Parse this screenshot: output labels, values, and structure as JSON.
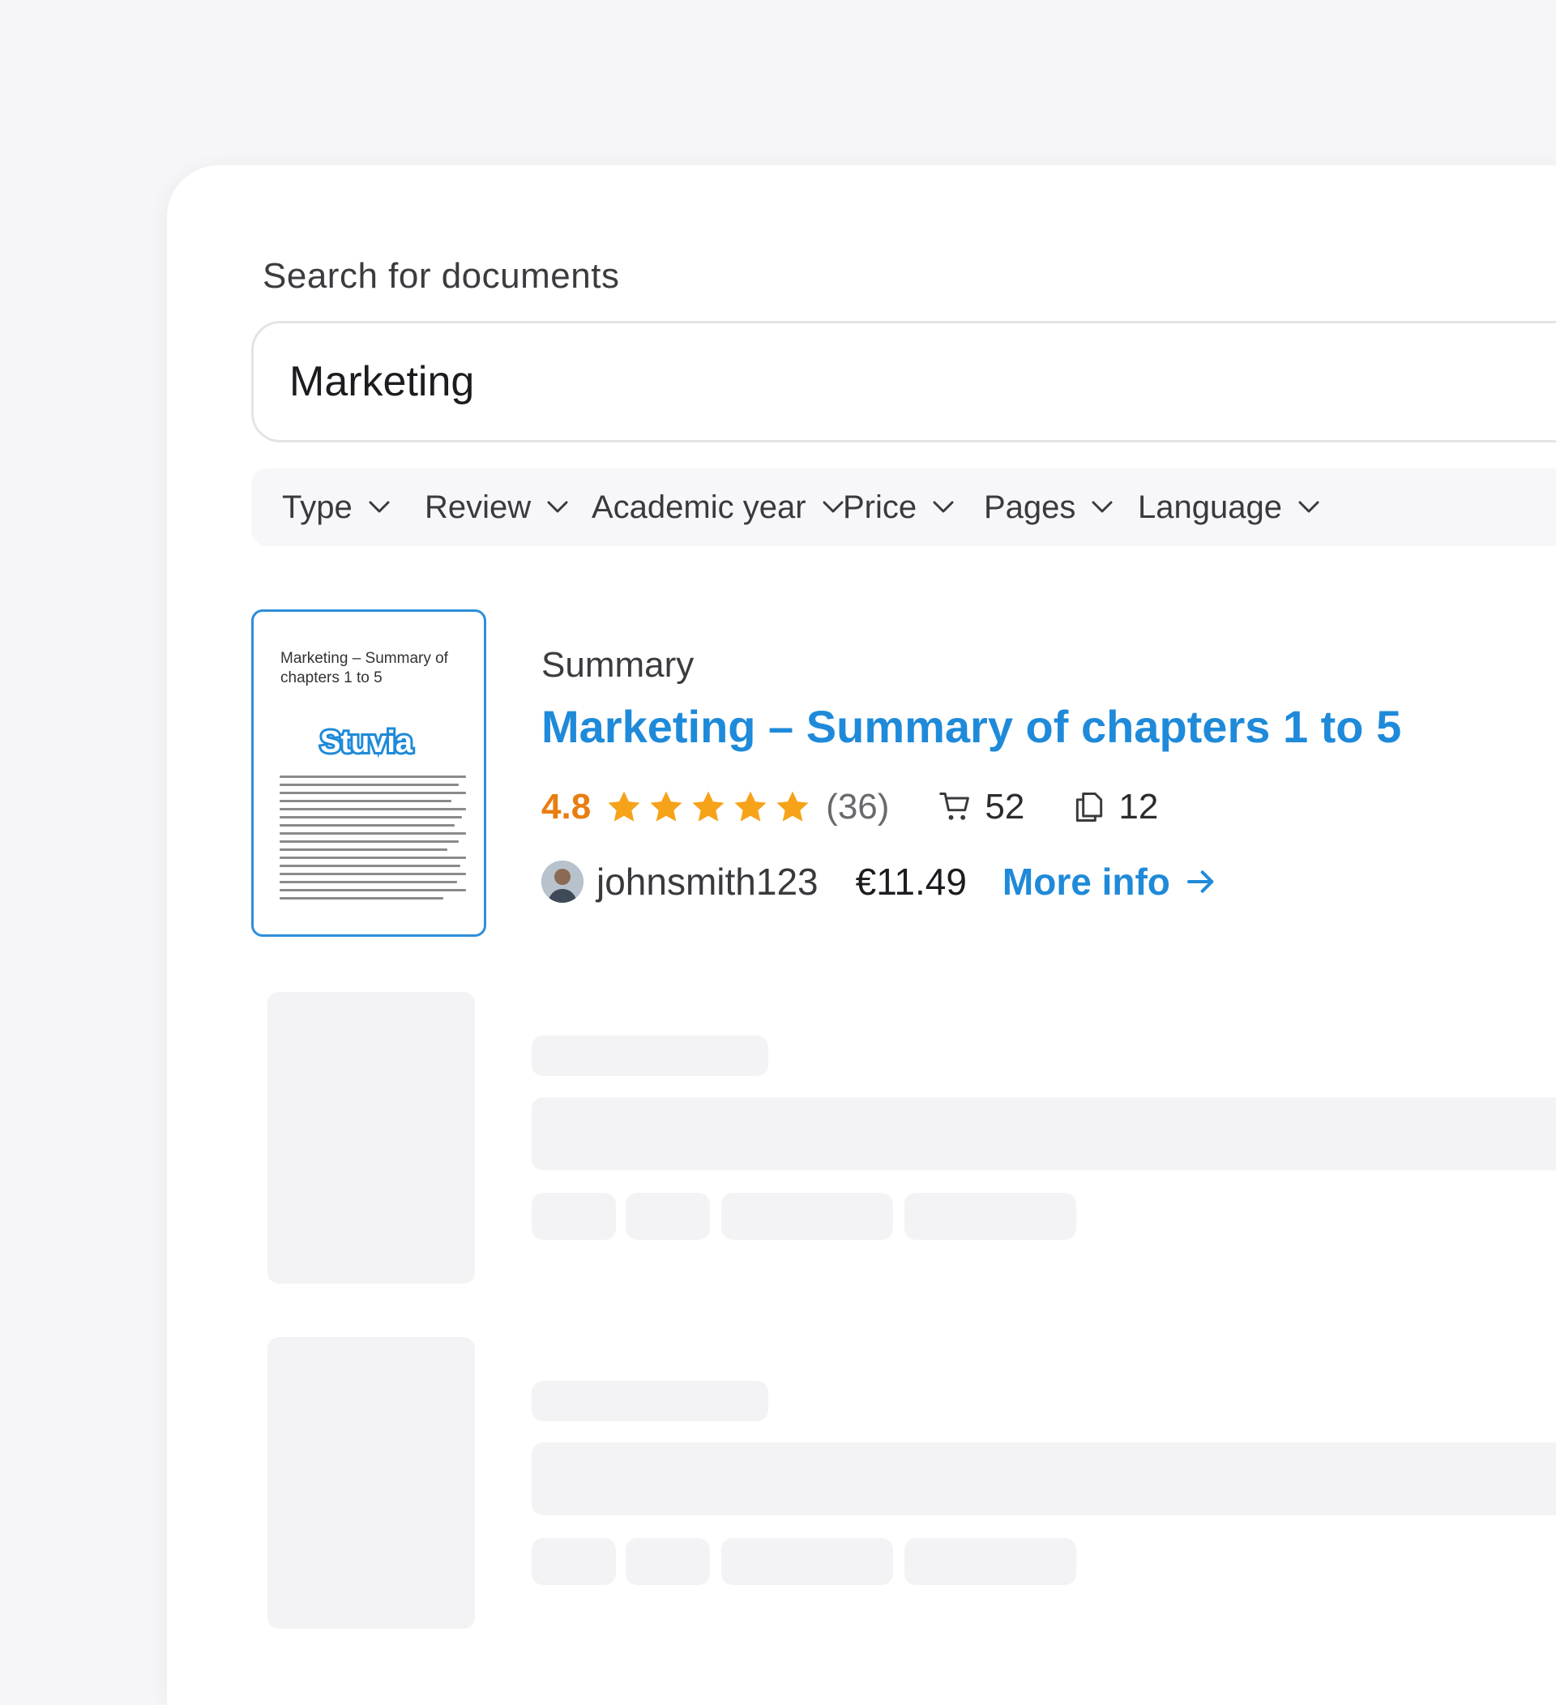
{
  "search": {
    "label": "Search for documents",
    "value": "Marketing"
  },
  "filters": [
    {
      "label": "Type"
    },
    {
      "label": "Review"
    },
    {
      "label": "Academic year"
    },
    {
      "label": "Price"
    },
    {
      "label": "Pages"
    },
    {
      "label": "Language"
    }
  ],
  "result": {
    "thumb_title": "Marketing – Summary of chapters 1 to 5",
    "thumb_logo": "Stuvia",
    "type": "Summary",
    "title": "Marketing – Summary of chapters 1 to 5",
    "rating": "4.8",
    "stars": 5,
    "review_count": "(36)",
    "sales": "52",
    "pages": "12",
    "author": "johnsmith123",
    "price": "€11.49",
    "more_label": "More info"
  },
  "colors": {
    "accent": "#1f8ad9",
    "rating": "#e97d12",
    "star": "#f6a31a"
  }
}
